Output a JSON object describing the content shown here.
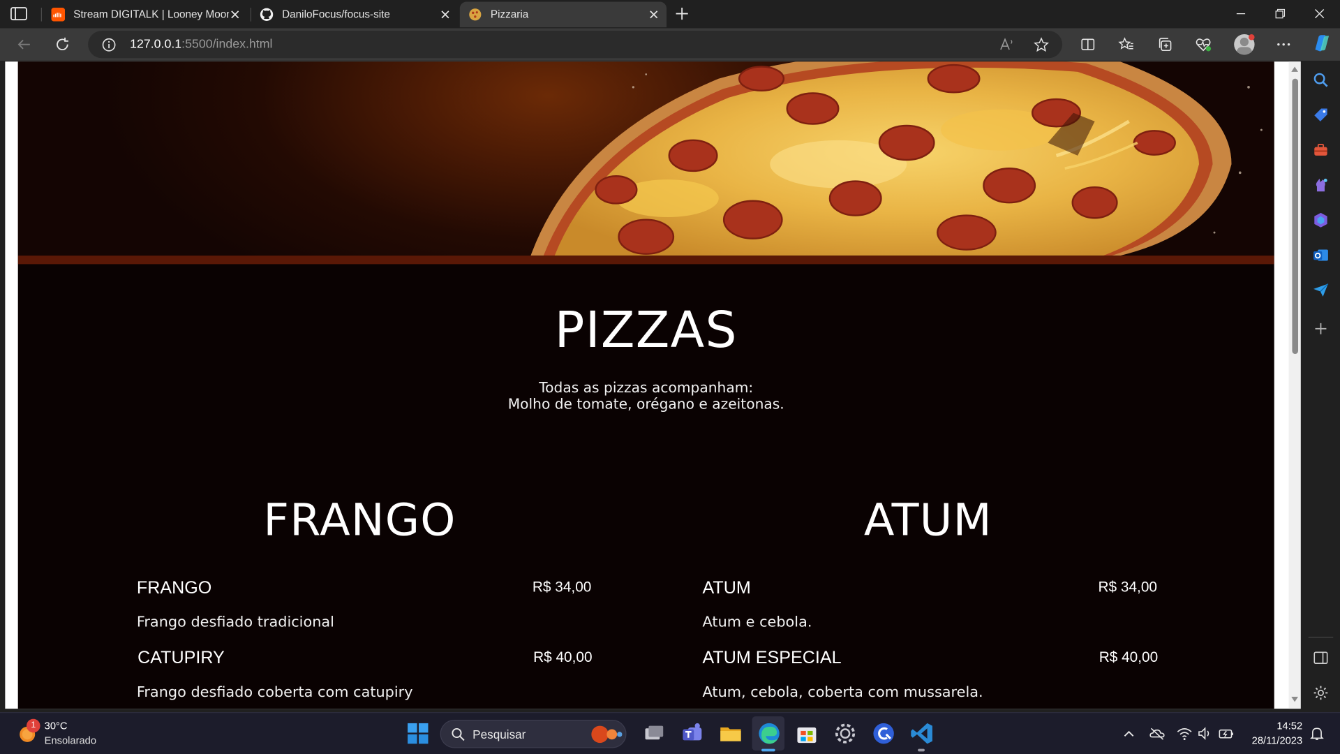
{
  "browser": {
    "tabs": [
      {
        "title": "Stream DIGITALK | Looney Moon",
        "favicon": "soundcloud-icon",
        "active": false
      },
      {
        "title": "DaniloFocus/focus-site",
        "favicon": "github-icon",
        "active": false
      },
      {
        "title": "Pizzaria",
        "favicon": "pizza-icon",
        "active": true
      }
    ],
    "address": {
      "host": "127.0.0.1",
      "path": ":5500/index.html"
    }
  },
  "page": {
    "title": "PIZZAS",
    "subtitle_line1": "Todas as pizzas acompanham:",
    "subtitle_line2": "Molho de tomate, orégano e azeitonas.",
    "columns": [
      {
        "title": "FRANGO",
        "items": [
          {
            "name": "FRANGO",
            "price": "R$ 34,00",
            "description": "Frango desfiado tradicional"
          },
          {
            "name": "CATUPIRY",
            "price": "R$ 40,00",
            "description": "Frango desfiado coberta com catupiry"
          }
        ]
      },
      {
        "title": "ATUM",
        "items": [
          {
            "name": "ATUM",
            "price": "R$ 34,00",
            "description": "Atum e cebola."
          },
          {
            "name": "ATUM ESPECIAL",
            "price": "R$ 40,00",
            "description": "Atum, cebola, coberta com mussarela."
          }
        ]
      }
    ]
  },
  "taskbar": {
    "weather": {
      "temp": "30°C",
      "desc": "Ensolarado",
      "badge": "1"
    },
    "search_label": "Pesquisar",
    "clock": {
      "time": "14:52",
      "date": "28/11/2023"
    }
  },
  "colors": {
    "page_bg": "#0a0202",
    "band": "#5a1806",
    "accent_orange": "#6b2a06"
  }
}
